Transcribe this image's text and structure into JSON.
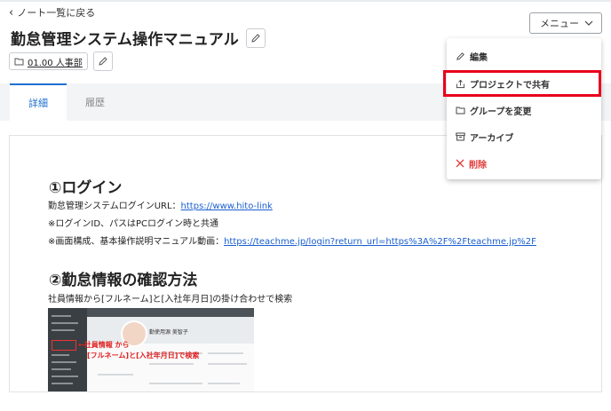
{
  "nav": {
    "back_label": "ノート一覧に戻る"
  },
  "header": {
    "title": "勤怠管理システム操作マニュアル",
    "department": "01.00 人事部",
    "menu_label": "メニュー"
  },
  "tabs": [
    {
      "label": "詳細",
      "active": true
    },
    {
      "label": "履歴",
      "active": false
    }
  ],
  "dropdown": {
    "items": [
      {
        "label": "編集",
        "icon": "pencil-icon"
      },
      {
        "label": "プロジェクトで共有",
        "icon": "share-icon"
      },
      {
        "label": "グループを変更",
        "icon": "folder-icon"
      },
      {
        "label": "アーカイブ",
        "icon": "archive-icon"
      },
      {
        "label": "削除",
        "icon": "close-icon"
      }
    ]
  },
  "content": {
    "section1_title": "①ログイン",
    "line1_text": "勤怠管理システムログインURL：",
    "line1_link": "https://www.hito-link",
    "line2_text": "※ログインID、パスはPCログイン時と共通",
    "line3_text": "※画面構成、基本操作説明マニュアル動画：",
    "line3_link": "https://teachme.jp/login?return_url=https%3A%2F%2Fteachme.jp%2F",
    "section2_title": "②勤怠情報の確認方法",
    "line4_text": "社員情報から[フルネーム]と[入社年月日]の掛け合わせで検索",
    "screenshot": {
      "name_label": "勤使用源 美智子",
      "annotation_line1": "←社員情報 から",
      "annotation_line2": "[フルネーム]と[入社年月日]で検索"
    }
  },
  "colors": {
    "accent": "#1f6fd0",
    "danger": "#e23b3b",
    "highlight": "#e8001c",
    "link": "#1a5fd0"
  }
}
